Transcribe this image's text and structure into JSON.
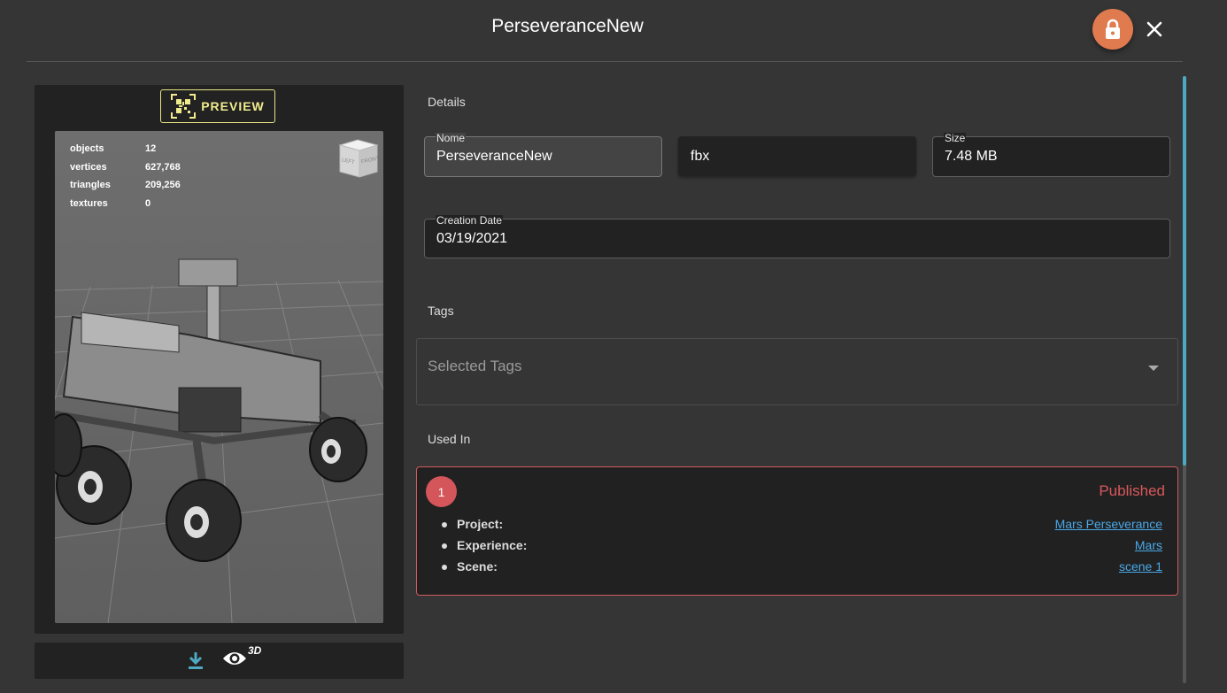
{
  "header": {
    "title": "PerseveranceNew"
  },
  "preview": {
    "button_label": "PREVIEW",
    "stats": [
      {
        "key": "objects",
        "value": "12"
      },
      {
        "key": "vertices",
        "value": "627,768"
      },
      {
        "key": "triangles",
        "value": "209,256"
      },
      {
        "key": "textures",
        "value": "0"
      }
    ],
    "viewcube_faces": [
      "LEFT",
      "FRONT"
    ],
    "eye_label": "3D"
  },
  "details": {
    "section_label": "Details",
    "name_label": "Nome",
    "name_value": "PerseveranceNew",
    "format_value": "fbx",
    "size_label": "Size",
    "size_value": "7.48 MB",
    "date_label": "Creation Date",
    "date_value": "03/19/2021"
  },
  "tags": {
    "section_label": "Tags",
    "placeholder": "Selected Tags"
  },
  "used_in": {
    "section_label": "Used In",
    "count": "1",
    "status": "Published",
    "rows": [
      {
        "key": "Project:",
        "value": "Mars Perseverance"
      },
      {
        "key": "Experience:",
        "value": "Mars"
      },
      {
        "key": "Scene:",
        "value": "scene 1"
      }
    ]
  },
  "colors": {
    "accent_orange": "#e07b4f",
    "preview_yellow": "#f0ec8e",
    "published_red": "#d9585d",
    "link_blue": "#4aa8e8",
    "scroll_teal": "#4fa8c2"
  },
  "icons": [
    "lock-icon",
    "close-icon",
    "qr-code-icon",
    "view-cube-icon",
    "download-icon",
    "eye-icon",
    "dropdown-arrow-icon"
  ]
}
